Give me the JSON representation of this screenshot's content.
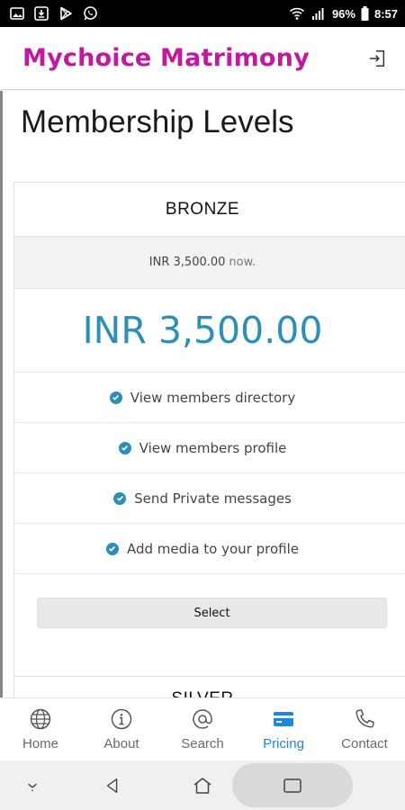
{
  "status_bar": {
    "battery": "96%",
    "time": "8:57"
  },
  "app_bar": {
    "title": "Mychoice Matrimony"
  },
  "page": {
    "title": "Membership Levels"
  },
  "plans": [
    {
      "name": "BRONZE",
      "subtitle_price": "INR 3,500.00",
      "subtitle_suffix": "now.",
      "price": "INR 3,500.00",
      "features": [
        "View members directory",
        "View members profile",
        "Send Private messages",
        "Add media to your profile"
      ],
      "select_label": "Select"
    },
    {
      "name": "SILVER"
    }
  ],
  "bottom_nav": {
    "items": [
      {
        "label": "Home",
        "icon": "globe-icon"
      },
      {
        "label": "About",
        "icon": "info-icon"
      },
      {
        "label": "Search",
        "icon": "at-icon"
      },
      {
        "label": "Pricing",
        "icon": "credit-card-icon"
      },
      {
        "label": "Contact",
        "icon": "phone-icon"
      }
    ],
    "active": "Pricing",
    "active_color": "#1d86e0"
  },
  "colors": {
    "brand": "#c1199f",
    "accent": "#2c8fb5"
  }
}
